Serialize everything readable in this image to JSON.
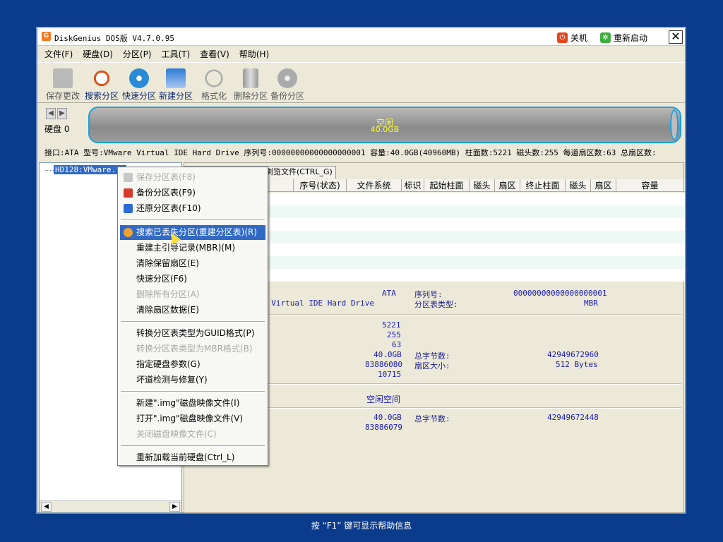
{
  "window": {
    "title": "DiskGenius DOS版 V4.7.0.95",
    "shutdown_label": "关机",
    "restart_label": "重新启动",
    "close_glyph": "✕"
  },
  "menu": [
    "文件(F)",
    "硬盘(D)",
    "分区(P)",
    "工具(T)",
    "查看(V)",
    "帮助(H)"
  ],
  "toolbar": [
    {
      "label": "保存更改",
      "state": "disabled"
    },
    {
      "label": "搜索分区",
      "state": "active"
    },
    {
      "label": "快速分区",
      "state": "active"
    },
    {
      "label": "新建分区",
      "state": "active"
    },
    {
      "label": "格式化",
      "state": "disabled"
    },
    {
      "label": "删除分区",
      "state": "disabled"
    },
    {
      "label": "备份分区",
      "state": "disabled"
    }
  ],
  "disk": {
    "label": "硬盘 0",
    "free_label": "空闲",
    "free_size": "40.0GB"
  },
  "info_line": "接口:ATA  型号:VMware Virtual IDE Hard Drive  序列号:00000000000000000001  容量:40.0GB(40960MB)  柱面数:5221  磁头数:255  每道扇区数:63  总扇区数:",
  "tree": {
    "item": "HD128:VMware..."
  },
  "tabs": [
    "...",
    "浏览文件(CTRL_G)"
  ],
  "columns": [
    "序号(状态)",
    "文件系统",
    "标识",
    "起始柱面",
    "磁头",
    "扇区",
    "终止柱面",
    "磁头",
    "扇区",
    "容量"
  ],
  "details": {
    "iface": "ATA",
    "model": "e Virtual IDE Hard Drive",
    "serial_label": "序列号:",
    "serial": "00000000000000000001",
    "ptype_label": "分区表类型:",
    "ptype": "MBR",
    "cyl": "5221",
    "heads": "255",
    "spt": "63",
    "cap": "40.0GB",
    "total_bytes_label": "总字节数:",
    "total_bytes": "42949672960",
    "sectors": "83886080",
    "sector_size_label": "扇区大小:",
    "sector_size": "512 Bytes",
    "extra": "10715",
    "free_space": "空闲空间",
    "free_cap": "40.0GB",
    "free_bytes_label": "总字节数:",
    "free_bytes": "42949672448",
    "free_sectors": "83886079"
  },
  "context_menu": [
    {
      "label": "保存分区表(F8)",
      "disabled": true
    },
    {
      "label": "备份分区表(F9)",
      "disabled": false
    },
    {
      "label": "还原分区表(F10)",
      "disabled": false
    },
    {
      "label": "搜索已丢失分区(重建分区表)(R)",
      "disabled": false,
      "highlight": true
    },
    {
      "label": "重建主引导记录(MBR)(M)",
      "disabled": false
    },
    {
      "label": "清除保留扇区(E)",
      "disabled": false
    },
    {
      "label": "快速分区(F6)",
      "disabled": false
    },
    {
      "label": "删除所有分区(A)",
      "disabled": true
    },
    {
      "label": "清除扇区数据(E)",
      "disabled": false
    },
    {
      "label": "转换分区表类型为GUID格式(P)",
      "disabled": false
    },
    {
      "label": "转换分区表类型为MBR格式(B)",
      "disabled": true
    },
    {
      "label": "指定硬盘参数(G)",
      "disabled": false
    },
    {
      "label": "坏道检测与修复(Y)",
      "disabled": false
    },
    {
      "label": "新建\".img\"磁盘映像文件(I)",
      "disabled": false
    },
    {
      "label": "打开\".img\"磁盘映像文件(V)",
      "disabled": false
    },
    {
      "label": "关闭磁盘映像文件(C)",
      "disabled": true
    },
    {
      "label": "重新加载当前硬盘(Ctrl_L)",
      "disabled": false
    }
  ],
  "status": "按 “F1” 键可显示帮助信息"
}
